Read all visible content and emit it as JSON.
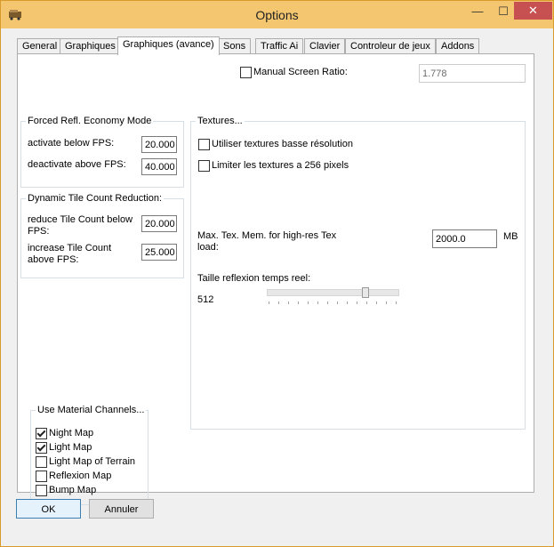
{
  "window": {
    "title": "Options",
    "close_glyph": "✕",
    "min_glyph": "—",
    "max_glyph": "☐"
  },
  "tabs": [
    {
      "label": "General",
      "active": false
    },
    {
      "label": "Graphiques",
      "active": false
    },
    {
      "label": "Graphiques (avance)",
      "active": true
    },
    {
      "label": "Sons",
      "active": false
    },
    {
      "label": "Traffic Ai",
      "active": false
    },
    {
      "label": "Clavier",
      "active": false
    },
    {
      "label": "Controleur de jeux",
      "active": false
    },
    {
      "label": "Addons",
      "active": false
    }
  ],
  "screen_ratio": {
    "label": "Manual Screen Ratio:",
    "checked": false,
    "value": "1.778"
  },
  "forced_refl": {
    "title": "Forced Refl. Economy Mode",
    "activate_label": "activate below FPS:",
    "activate_value": "20.000",
    "deactivate_label": "deactivate above FPS:",
    "deactivate_value": "40.000"
  },
  "tile_count": {
    "title": "Dynamic Tile Count Reduction:",
    "reduce_label_1": "reduce Tile Count below",
    "reduce_label_2": "FPS:",
    "reduce_value": "20.000",
    "increase_label_1": "increase Tile Count",
    "increase_label_2": "above FPS:",
    "increase_value": "25.000"
  },
  "textures": {
    "title": "Textures...",
    "low_res_label": "Utiliser textures basse résolution",
    "low_res_checked": false,
    "limit_label": "Limiter les textures a 256 pixels",
    "limit_checked": false,
    "maxmem_label_1": "Max. Tex. Mem. for high-res Tex",
    "maxmem_label_2": "load:",
    "maxmem_value": "2000.0",
    "maxmem_unit": "MB",
    "reflection_label": "Taille reflexion temps reel:",
    "reflection_value": "512"
  },
  "material": {
    "title": "Use Material Channels...",
    "items": [
      {
        "label": "Night Map",
        "checked": true
      },
      {
        "label": "Light Map",
        "checked": true
      },
      {
        "label": "Light Map of Terrain",
        "checked": false
      },
      {
        "label": "Reflexion Map",
        "checked": false
      },
      {
        "label": "Bump Map",
        "checked": false
      }
    ]
  },
  "buttons": {
    "ok": "OK",
    "cancel": "Annuler"
  }
}
